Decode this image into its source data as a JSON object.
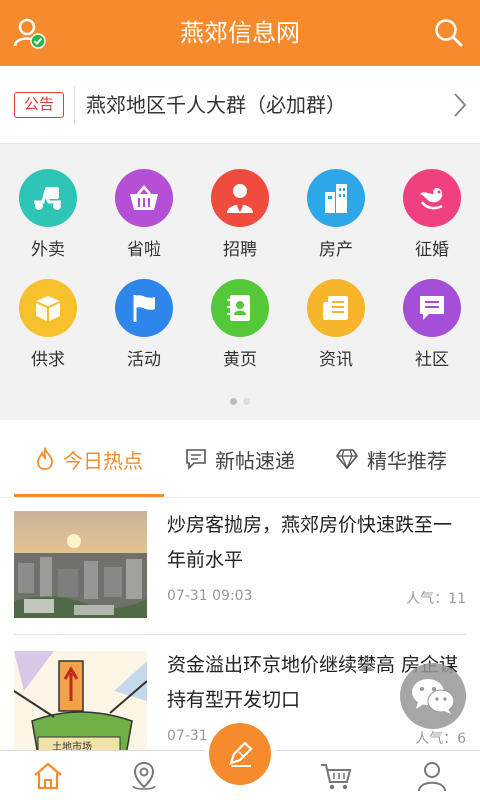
{
  "header": {
    "title": "燕郊信息网"
  },
  "notice": {
    "badge": "公告",
    "text": "燕郊地区千人大群（必加群）"
  },
  "grid": {
    "items": [
      {
        "label": "外卖",
        "icon": "scooter-icon",
        "color": "#2ec4b6"
      },
      {
        "label": "省啦",
        "icon": "basket-icon",
        "color": "#b44fd6"
      },
      {
        "label": "招聘",
        "icon": "person-tie-icon",
        "color": "#ef4b3e"
      },
      {
        "label": "房产",
        "icon": "building-icon",
        "color": "#2ea7e8"
      },
      {
        "label": "征婚",
        "icon": "bird-icon",
        "color": "#f0407f"
      },
      {
        "label": "供求",
        "icon": "box-icon",
        "color": "#f7c02d"
      },
      {
        "label": "活动",
        "icon": "flag-icon",
        "color": "#2f86ea"
      },
      {
        "label": "黄页",
        "icon": "contact-book-icon",
        "color": "#55c83a"
      },
      {
        "label": "资讯",
        "icon": "news-icon",
        "color": "#f7b52b"
      },
      {
        "label": "社区",
        "icon": "message-icon",
        "color": "#a34fd8"
      }
    ],
    "page_dots": 2,
    "active_dot": 0
  },
  "tabs": [
    {
      "label": "今日热点",
      "icon": "flame-icon",
      "active": true
    },
    {
      "label": "新帖速递",
      "icon": "comment-icon",
      "active": false
    },
    {
      "label": "精华推荐",
      "icon": "diamond-icon",
      "active": false
    }
  ],
  "feed": [
    {
      "headline": "炒房客抛房，燕郊房价快速跌至一年前水平",
      "date": "07-31 09:03",
      "popularity": "人气：11"
    },
    {
      "headline": "资金溢出环京地价继续攀高 房企谋持有型开发切口",
      "date": "07-31 0",
      "popularity": "人气：6",
      "thumb_sign": "土地市场"
    }
  ],
  "bottom_nav": [
    "home-icon",
    "location-icon",
    "compose-icon",
    "cart-icon",
    "profile-icon"
  ],
  "colors": {
    "accent": "#f58b2c",
    "notice_red": "#e23b3b"
  }
}
